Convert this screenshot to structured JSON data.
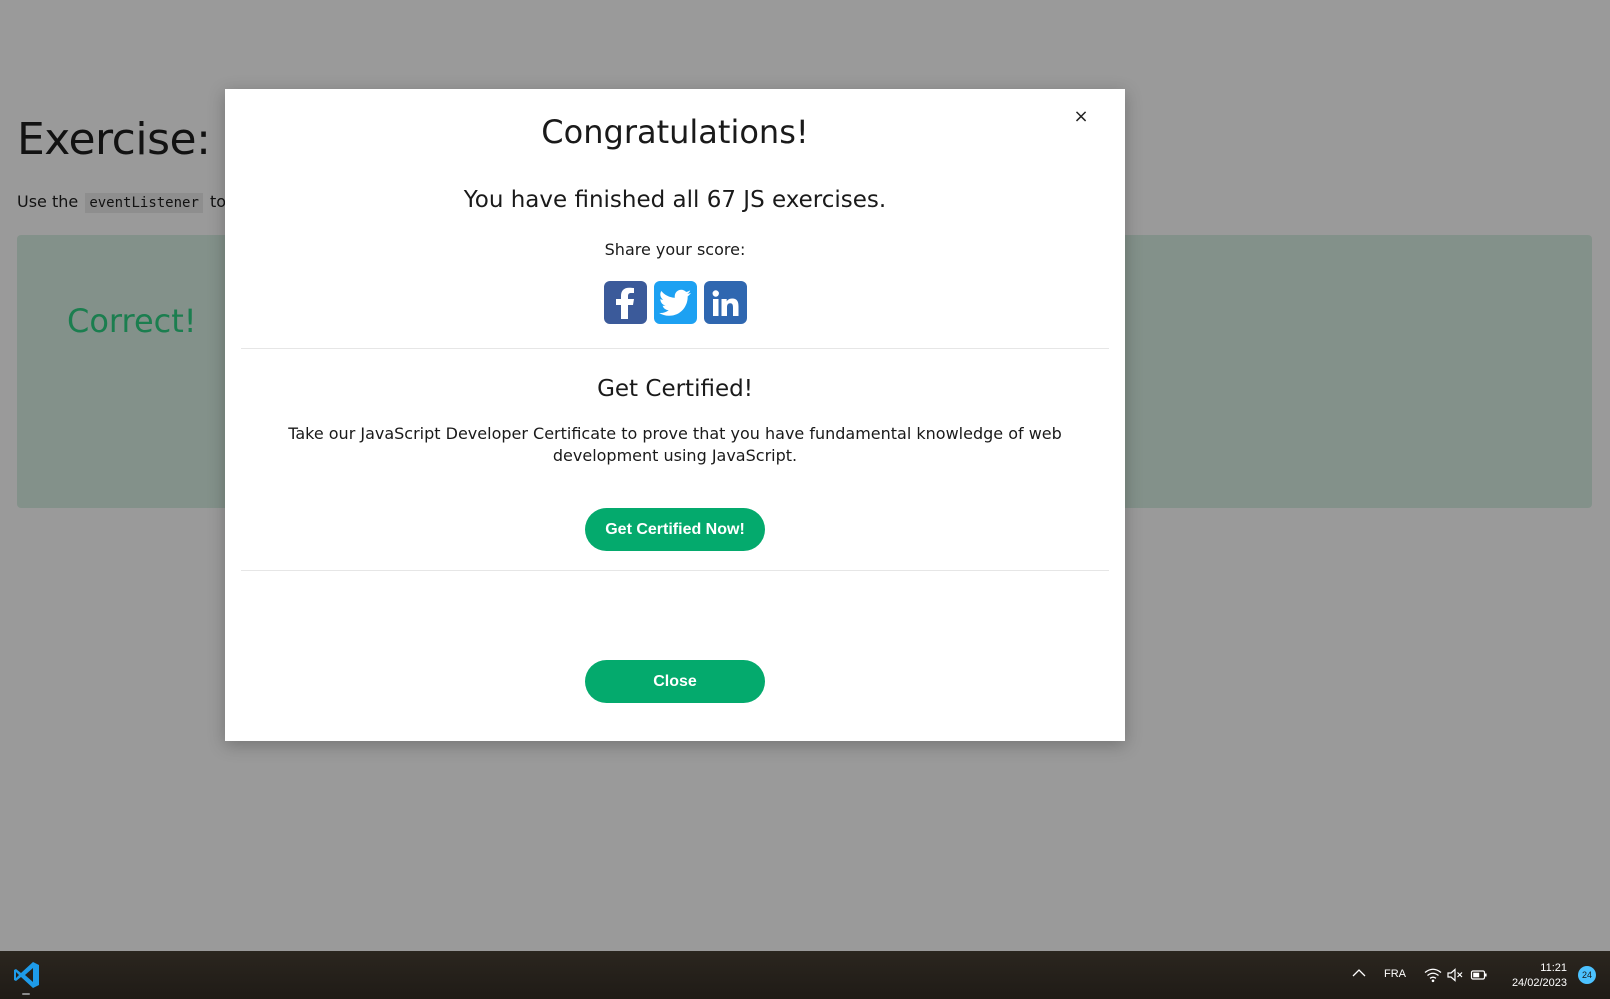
{
  "background": {
    "exercise_title": "Exercise:",
    "desc_before": "Use the",
    "desc_code": "eventListener",
    "desc_after": "to",
    "correct_text": "Correct!"
  },
  "modal": {
    "close_symbol": "×",
    "title": "Congratulations!",
    "finished_text": "You have finished all 67 JS exercises.",
    "share_label": "Share your score:",
    "social": [
      {
        "icon": "facebook-icon",
        "color": "#3b5a9a"
      },
      {
        "icon": "twitter-icon",
        "color": "#1da1f2"
      },
      {
        "icon": "linkedin-icon",
        "color": "#2f67b0"
      }
    ],
    "cert_title": "Get Certified!",
    "cert_desc": "Take our JavaScript Developer Certificate to prove that you have fundamental knowledge of web development using JavaScript.",
    "cert_button": "Get Certified Now!",
    "close_button": "Close"
  },
  "taskbar": {
    "app_icon": "vscode-icon",
    "tray_chevron": "^",
    "language": "FRA",
    "time": "11:21",
    "date": "24/02/2023",
    "notification_count": "24"
  },
  "colors": {
    "accent_green": "#04aa6d",
    "correct_green": "#1b7e4f",
    "overlay": "#9a9a9a"
  }
}
